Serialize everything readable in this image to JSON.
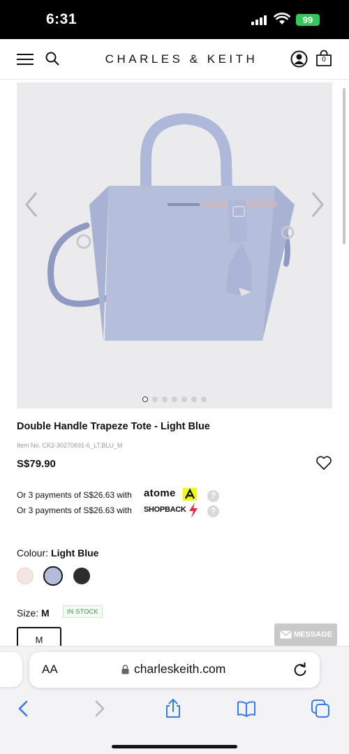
{
  "status_bar": {
    "time": "6:31",
    "battery": "99"
  },
  "header": {
    "brand": "CHARLES & KEITH",
    "bag_count": "0"
  },
  "gallery": {
    "dot_count": 7,
    "active_index": 0
  },
  "product": {
    "name": "Double Handle Trapeze Tote - Light Blue",
    "item_no": "Item No. CK2-30270691-6_LT.BLU_M",
    "price": "S$79.90"
  },
  "payments": [
    {
      "text": "Or 3 payments of S$26.63 with",
      "provider": "atome"
    },
    {
      "text": "Or 3 payments of S$26.63 with",
      "provider": "SHOPBACK"
    }
  ],
  "colour": {
    "label": "Colour:",
    "selected": "Light Blue",
    "swatches": [
      "#f3e6e2",
      "#b3bdd9",
      "#2d2d2d"
    ]
  },
  "size": {
    "label": "Size:",
    "selected": "M",
    "stock": "IN STOCK",
    "option": "M"
  },
  "message_button": "MESSAGE",
  "safari": {
    "aa": "AA",
    "url": "charleskeith.com"
  },
  "colors": {
    "bag": "#b5bfdc",
    "background": "#ebebed",
    "atome_yellow": "#f0ff00"
  }
}
